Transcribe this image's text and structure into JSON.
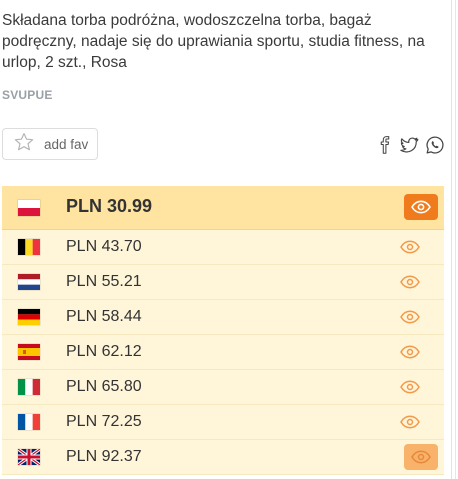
{
  "product": {
    "title": "Składana torba podróżna, wodoszczelna torba, bagaż podręczny, nadaje się do uprawiania sportu, studia fitness, na urlop, 2 szt., Rosa",
    "brand": "SVUPUE"
  },
  "actions": {
    "fav_label": "add fav",
    "share_icons": [
      "facebook-icon",
      "twitter-icon",
      "whatsapp-icon"
    ]
  },
  "prices": [
    {
      "country": "Poland",
      "flag": "pl-flag-icon",
      "price": "PLN 30.99",
      "best": true
    },
    {
      "country": "Belgium",
      "flag": "be-flag-icon",
      "price": "PLN 43.70"
    },
    {
      "country": "Netherlands",
      "flag": "nl-flag-icon",
      "price": "PLN 55.21"
    },
    {
      "country": "Germany",
      "flag": "de-flag-icon",
      "price": "PLN 58.44"
    },
    {
      "country": "Spain",
      "flag": "es-flag-icon",
      "price": "PLN 62.12"
    },
    {
      "country": "Italy",
      "flag": "it-flag-icon",
      "price": "PLN 65.80"
    },
    {
      "country": "France",
      "flag": "fr-flag-icon",
      "price": "PLN 72.25"
    },
    {
      "country": "United Kingdom",
      "flag": "uk-flag-icon",
      "price": "PLN 92.37"
    }
  ],
  "colors": {
    "accent": "#f07b1d",
    "best_row_bg": "#ffe3a0",
    "row_bg": "#fff5d9",
    "brand_text": "#9aa0a6"
  }
}
